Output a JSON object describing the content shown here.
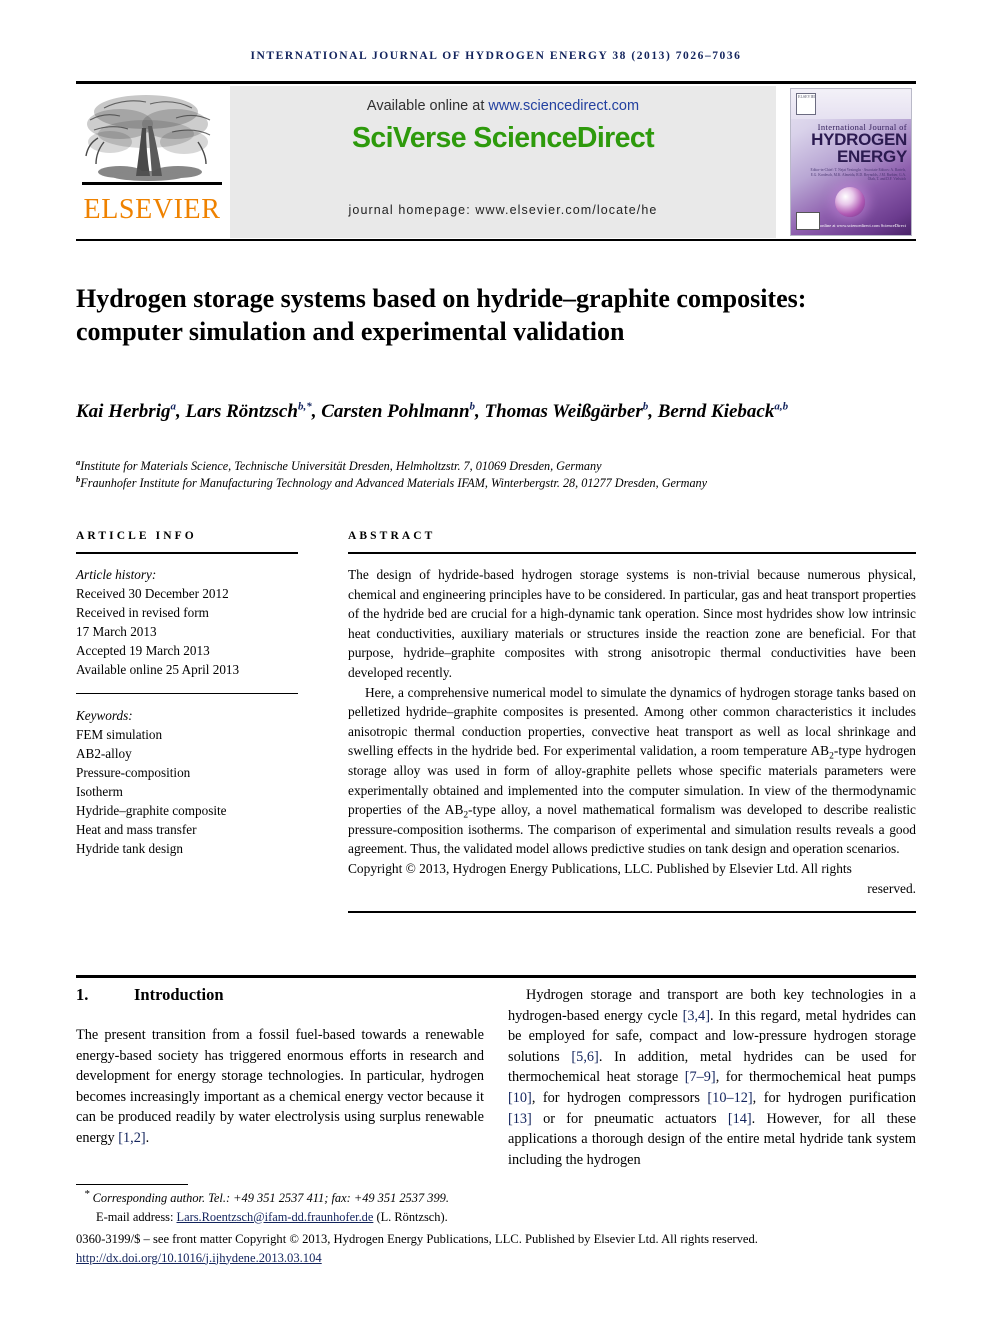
{
  "running_head": "International Journal of Hydrogen Energy 38 (2013) 7026–7036",
  "masthead": {
    "publisher_wordmark": "ELSEVIER",
    "available_prefix": "Available online at ",
    "available_url": "www.sciencedirect.com",
    "platform_logo": "SciVerse ScienceDirect",
    "journal_homepage": "journal homepage: www.elsevier.com/locate/he",
    "cover": {
      "line1": "International Journal of",
      "line2": "HYDROGEN",
      "line3": "ENERGY",
      "editors": "Editor-in-Chief: T. Nejat Veziroglu · Associate Editors: A. Bartels, E.G. Kordesch, M.K. Almeida, R.D. Reynolds, J.M. Barbier, G.A. Olah, T. and D.F. Vielstich",
      "sciencedirect_mark": "Available online at www.sciencedirect.com ScienceDirect"
    }
  },
  "title": "Hydrogen storage systems based on hydride–graphite composites: computer simulation and experimental validation",
  "authors": [
    {
      "name": "Kai Herbrig",
      "marks": "a",
      "sep": ", "
    },
    {
      "name": "Lars Röntzsch",
      "marks": "b,*",
      "sep": ", "
    },
    {
      "name": "Carsten Pohlmann",
      "marks": "b",
      "sep": ", "
    },
    {
      "name": "Thomas Weißgärber",
      "marks": "b",
      "sep": ", "
    },
    {
      "name": "Bernd Kieback",
      "marks": "a,b",
      "sep": ""
    }
  ],
  "affiliations": [
    {
      "mark": "a",
      "text": "Institute for Materials Science, Technische Universität Dresden, Helmholtzstr. 7, 01069 Dresden, Germany"
    },
    {
      "mark": "b",
      "text": "Fraunhofer Institute for Manufacturing Technology and Advanced Materials IFAM, Winterbergstr. 28, 01277 Dresden, Germany"
    }
  ],
  "article_info": {
    "heading": "Article info",
    "history_label": "Article history:",
    "history": [
      "Received 30 December 2012",
      "Received in revised form",
      "17 March 2013",
      "Accepted 19 March 2013",
      "Available online 25 April 2013"
    ],
    "keywords_label": "Keywords:",
    "keywords": [
      "FEM simulation",
      "AB2-alloy",
      "Pressure-composition",
      "Isotherm",
      "Hydride–graphite composite",
      "Heat and mass transfer",
      "Hydride tank design"
    ]
  },
  "abstract": {
    "heading": "Abstract",
    "paragraph_1": "The design of hydride-based hydrogen storage systems is non-trivial because numerous physical, chemical and engineering principles have to be considered. In particular, gas and heat transport properties of the hydride bed are crucial for a high-dynamic tank operation. Since most hydrides show low intrinsic heat conductivities, auxiliary materials or structures inside the reaction zone are beneficial. For that purpose, hydride–graphite composites with strong anisotropic thermal conductivities have been developed recently.",
    "paragraph_2_a": "Here, a comprehensive numerical model to simulate the dynamics of hydrogen storage tanks based on pelletized hydride–graphite composites is presented. Among other common characteristics it includes anisotropic thermal conduction properties, convective heat transport as well as local shrinkage and swelling effects in the hydride bed. For experimental validation, a room temperature AB",
    "paragraph_2_sub1": "2",
    "paragraph_2_b": "-type hydrogen storage alloy was used in form of alloy-graphite pellets whose specific materials parameters were experimentally obtained and implemented into the computer simulation. In view of the thermodynamic properties of the AB",
    "paragraph_2_sub2": "2",
    "paragraph_2_c": "-type alloy, a novel mathematical formalism was developed to describe realistic pressure-composition isotherms. The comparison of experimental and simulation results reveals a good agreement. Thus, the validated model allows predictive studies on tank design and operation scenarios.",
    "copyright_main": "Copyright © 2013, Hydrogen Energy Publications, LLC. Published by Elsevier Ltd. All rights",
    "copyright_last": "reserved."
  },
  "introduction": {
    "number": "1.",
    "heading": "Introduction",
    "left_paragraph_a": "The present transition from a fossil fuel-based towards a renewable energy-based society has triggered enormous efforts in research and development for energy storage technologies. In particular, hydrogen becomes increasingly important as a chemical energy vector because it can be produced readily by water electrolysis using surplus renewable energy ",
    "left_cite_1": "[1,2]",
    "left_paragraph_b": ".",
    "right_segments": [
      {
        "text": "Hydrogen storage and transport are both key technologies in a hydrogen-based energy cycle ",
        "cite": false
      },
      {
        "text": "[3,4]",
        "cite": true
      },
      {
        "text": ". In this regard, metal hydrides can be employed for safe, compact and low-pressure hydrogen storage solutions ",
        "cite": false
      },
      {
        "text": "[5,6]",
        "cite": true
      },
      {
        "text": ". In addition, metal hydrides can be used for thermochemical heat storage ",
        "cite": false
      },
      {
        "text": "[7–9]",
        "cite": true
      },
      {
        "text": ", for thermochemical heat pumps ",
        "cite": false
      },
      {
        "text": "[10]",
        "cite": true
      },
      {
        "text": ", for hydrogen compressors ",
        "cite": false
      },
      {
        "text": "[10–12]",
        "cite": true
      },
      {
        "text": ", for hydrogen purification ",
        "cite": false
      },
      {
        "text": "[13]",
        "cite": true
      },
      {
        "text": " or for pneumatic actuators ",
        "cite": false
      },
      {
        "text": "[14]",
        "cite": true
      },
      {
        "text": ". However, for all these applications a thorough design of the entire metal hydride tank system including the hydrogen",
        "cite": false
      }
    ]
  },
  "footnotes": {
    "corresponding": "Corresponding author. Tel.: +49 351 2537 411; fax: +49 351 2537 399.",
    "email_label": "E-mail address: ",
    "email": "Lars.Roentzsch@ifam-dd.fraunhofer.de",
    "email_suffix": " (L. Röntzsch).",
    "issn_copyright": "0360-3199/$ – see front matter Copyright © 2013, Hydrogen Energy Publications, LLC. Published by Elsevier Ltd. All rights reserved.",
    "doi": "http://dx.doi.org/10.1016/j.ijhydene.2013.03.104"
  },
  "colors": {
    "link": "#12235c",
    "sciencedirect_green": "#2e9a0c",
    "elsevier_orange": "#ef8200",
    "banner_gray": "#e9e9e9"
  }
}
